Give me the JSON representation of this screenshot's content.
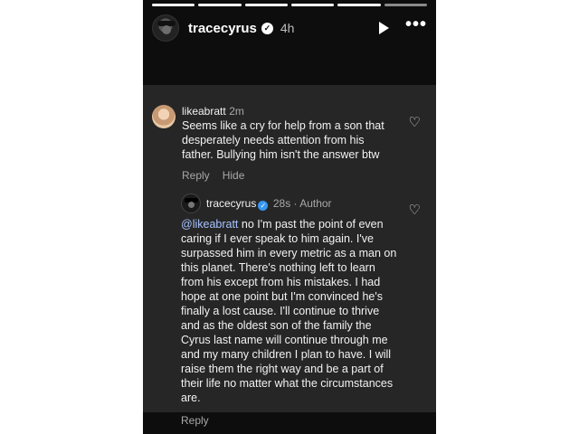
{
  "story": {
    "username": "tracecyrus",
    "time": "4h",
    "icons": {
      "verified": "verified-badge-icon",
      "play": "play-icon",
      "more": "more-icon"
    },
    "progress_segments": 6,
    "progress_done": 5
  },
  "comment1": {
    "username": "likeabratt",
    "time": "2m",
    "text": "Seems like a cry for help from a son that desperately needs attention from his father. Bullying him isn't the answer btw",
    "reply_label": "Reply",
    "hide_label": "Hide"
  },
  "comment2": {
    "username": "tracecyrus",
    "meta": "28s · Author",
    "mention": "@likeabratt",
    "text": " no I'm past the point of even caring if I ever speak to him again. I've surpassed him in every metric as a man on this planet. There's nothing left to learn from his except from his mistakes. I had hope at one point but I'm convinced he's finally a lost cause. I'll continue to thrive and as the oldest son of the family the Cyrus last name will continue through me and my many children I plan to have. I will raise them the right way and be a part of their life no matter what the circumstances are.",
    "reply_label": "Reply"
  },
  "colors": {
    "story_bg": "#0d0d0d",
    "card_bg": "#262626",
    "mention": "#a7c3ff",
    "verified_blue": "#3797f0"
  }
}
